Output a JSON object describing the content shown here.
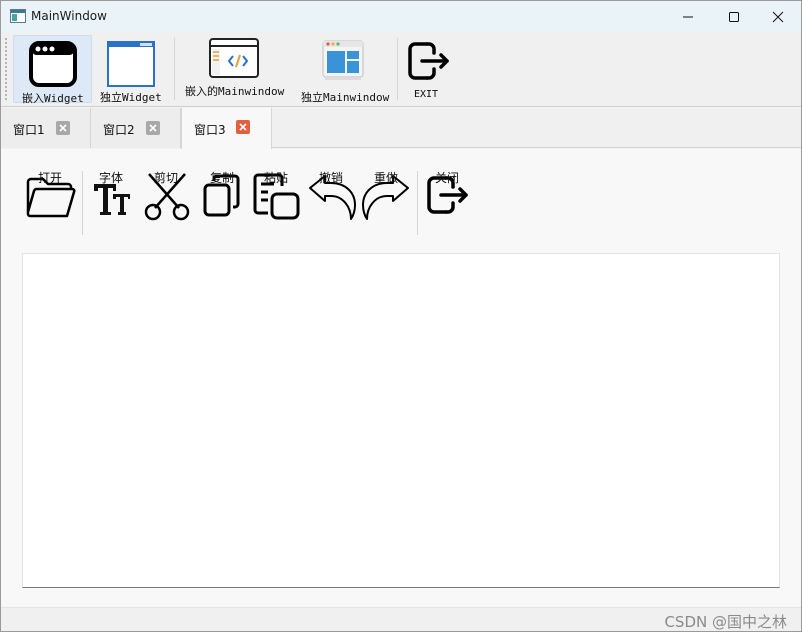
{
  "window": {
    "title": "MainWindow"
  },
  "toolbar": {
    "items": [
      {
        "label": "嵌入Widget",
        "icon": "embedded-window-icon",
        "active": true
      },
      {
        "label": "独立Widget",
        "icon": "standalone-window-icon",
        "active": false
      },
      {
        "label": "嵌入的Mainwindow",
        "icon": "code-window-icon",
        "active": false
      },
      {
        "label": "独立Mainwindow",
        "icon": "layout-window-icon",
        "active": false
      },
      {
        "label": "EXIT",
        "icon": "exit-icon",
        "active": false
      }
    ]
  },
  "tabs": [
    {
      "label": "窗口1",
      "selected": false
    },
    {
      "label": "窗口2",
      "selected": false
    },
    {
      "label": "窗口3",
      "selected": true
    }
  ],
  "page_toolbar": {
    "items": [
      {
        "label": "打开",
        "icon": "folder-icon"
      },
      {
        "label": "字体",
        "icon": "font-icon"
      },
      {
        "label": "剪切",
        "icon": "scissors-icon"
      },
      {
        "label": "复制",
        "icon": "copy-icon"
      },
      {
        "label": "粘贴",
        "icon": "paste-icon"
      },
      {
        "label": "撤销",
        "icon": "undo-icon"
      },
      {
        "label": "重做",
        "icon": "redo-icon"
      },
      {
        "label": "关闭",
        "icon": "close-door-icon"
      }
    ]
  },
  "editor": {
    "value": ""
  },
  "watermark": "CSDN @国中之林",
  "colors": {
    "titlebar": "#eaf3f8",
    "active_close": "#e0603f",
    "inactive_close": "#9a9a9a"
  }
}
